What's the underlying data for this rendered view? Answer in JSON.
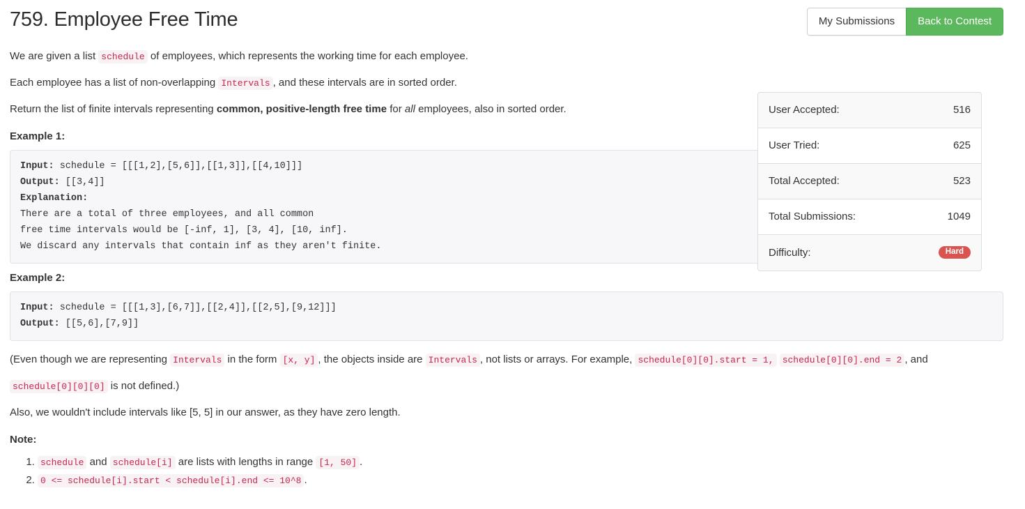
{
  "header": {
    "title": "759. Employee Free Time",
    "buttons": {
      "my_submissions": "My Submissions",
      "back_to_contest": "Back to Contest"
    }
  },
  "colors": {
    "success_green": "#5cb85c",
    "badge_red": "#d9534f",
    "inline_code_text": "#c7254e",
    "inline_code_bg": "#f9f2f4",
    "code_block_bg": "#f7f7f9",
    "panel_border": "#dddddd"
  },
  "description": {
    "p1": {
      "before": "We are given a list",
      "code": "schedule",
      "after": "of employees, which represents the working time for each employee."
    },
    "p2": {
      "before": "Each employee has a list of non-overlapping",
      "code": "Intervals",
      "after": ", and these intervals are in sorted order."
    },
    "p3": {
      "before": "Return the list of finite intervals representing",
      "bold": "common, positive-length free time",
      "mid": "for",
      "italic": "all",
      "after": "employees, also in sorted order."
    }
  },
  "examples": [
    {
      "heading": "Example 1:",
      "input_label": "Input:",
      "input_value": " schedule = [[[1,2],[5,6]],[[1,3]],[[4,10]]]",
      "output_label": "Output:",
      "output_value": " [[3,4]]",
      "explanation_label": "Explanation:",
      "explanation_lines": [
        "There are a total of three employees, and all common",
        "free time intervals would be [-inf, 1], [3, 4], [10, inf].",
        "We discard any intervals that contain inf as they aren't finite."
      ]
    },
    {
      "heading": "Example 2:",
      "input_label": "Input:",
      "input_value": " schedule = [[[1,3],[6,7]],[[2,4]],[[2,5],[9,12]]]",
      "output_label": "Output:",
      "output_value": " [[5,6],[7,9]]"
    }
  ],
  "footnote": {
    "s1": "(Even though we are representing",
    "c1": "Intervals",
    "s2": "in the form",
    "c2": "[x, y]",
    "s3": ", the objects inside are",
    "c3": "Intervals",
    "s4": ", not lists or arrays. For example,",
    "c4": "schedule[0][0].start = 1,",
    "c5": "schedule[0][0].end = 2",
    "s5": ", and",
    "c6": "schedule[0][0][0]",
    "s6": "is not defined.)"
  },
  "zero_length_note": "Also, we wouldn't include intervals like [5, 5] in our answer, as they have zero length.",
  "note": {
    "heading": "Note:",
    "items": [
      {
        "c1": "schedule",
        "s1": "and",
        "c2": "schedule[i]",
        "s2": "are lists with lengths in range",
        "c3": "[1, 50]",
        "s3": "."
      },
      {
        "c1": "0 <= schedule[i].start < schedule[i].end <= 10^8",
        "s1": "."
      }
    ]
  },
  "stats": {
    "rows": [
      {
        "label": "User Accepted:",
        "value": "516"
      },
      {
        "label": "User Tried:",
        "value": "625"
      },
      {
        "label": "Total Accepted:",
        "value": "523"
      },
      {
        "label": "Total Submissions:",
        "value": "1049"
      }
    ],
    "difficulty_label": "Difficulty:",
    "difficulty_value": "Hard"
  }
}
